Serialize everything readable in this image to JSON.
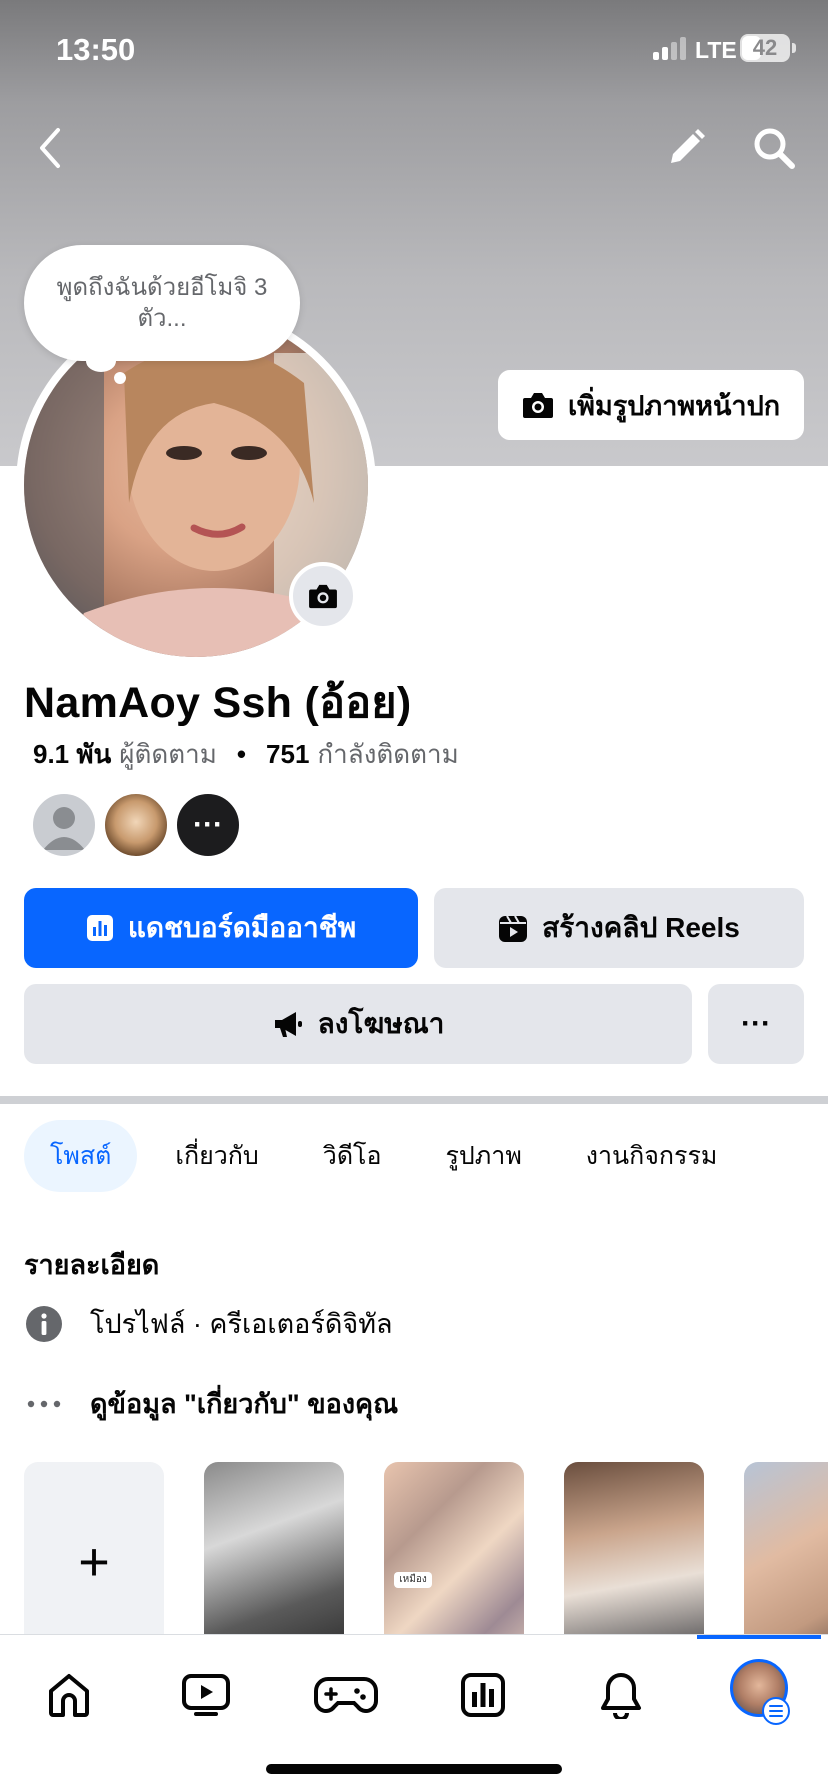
{
  "status_bar": {
    "time": "13:50",
    "network": "LTE",
    "battery": "42",
    "battery_level": 0.42
  },
  "header": {
    "back_icon": "chevron-left-icon",
    "edit_icon": "pencil-icon",
    "search_icon": "search-icon"
  },
  "cover": {
    "add_cover_label": "เพิ่มรูปภาพหน้าปก"
  },
  "profile": {
    "thought_bubble": "พูดถึงฉันด้วยอีโมจิ 3 ตัว...",
    "name": "NamAoy Ssh (อ้อย)",
    "followers_count": "9.1 พัน",
    "followers_label": "ผู้ติดตาม",
    "following_count": "751",
    "following_label": "กำลังติดตาม",
    "follower_more": "···"
  },
  "actions": {
    "dashboard_label": "แดชบอร์ดมืออาชีพ",
    "reels_label": "สร้างคลิป Reels",
    "ads_label": "ลงโฆษณา",
    "more_label": "···"
  },
  "tabs": [
    {
      "label": "โพสต์",
      "active": true
    },
    {
      "label": "เกี่ยวกับ",
      "active": false
    },
    {
      "label": "วิดีโอ",
      "active": false
    },
    {
      "label": "รูปภาพ",
      "active": false
    },
    {
      "label": "งานกิจกรรม",
      "active": false
    }
  ],
  "details": {
    "title": "รายละเอียด",
    "profile_type": "โปรไฟล์ · ครีเอเตอร์ดิจิทัล",
    "see_about": "ดูข้อมูล \"เกี่ยวกับ\" ของคุณ"
  },
  "highlights": {
    "add_label": "+",
    "sticker_text": "เหมือง"
  },
  "bottom_nav": {
    "items": [
      "home-icon",
      "video-icon",
      "gaming-icon",
      "dashboard-icon",
      "bell-icon",
      "profile-avatar"
    ]
  },
  "colors": {
    "accent": "#0866ff",
    "button_gray": "#e4e6eb",
    "secondary_text": "#65676b"
  }
}
